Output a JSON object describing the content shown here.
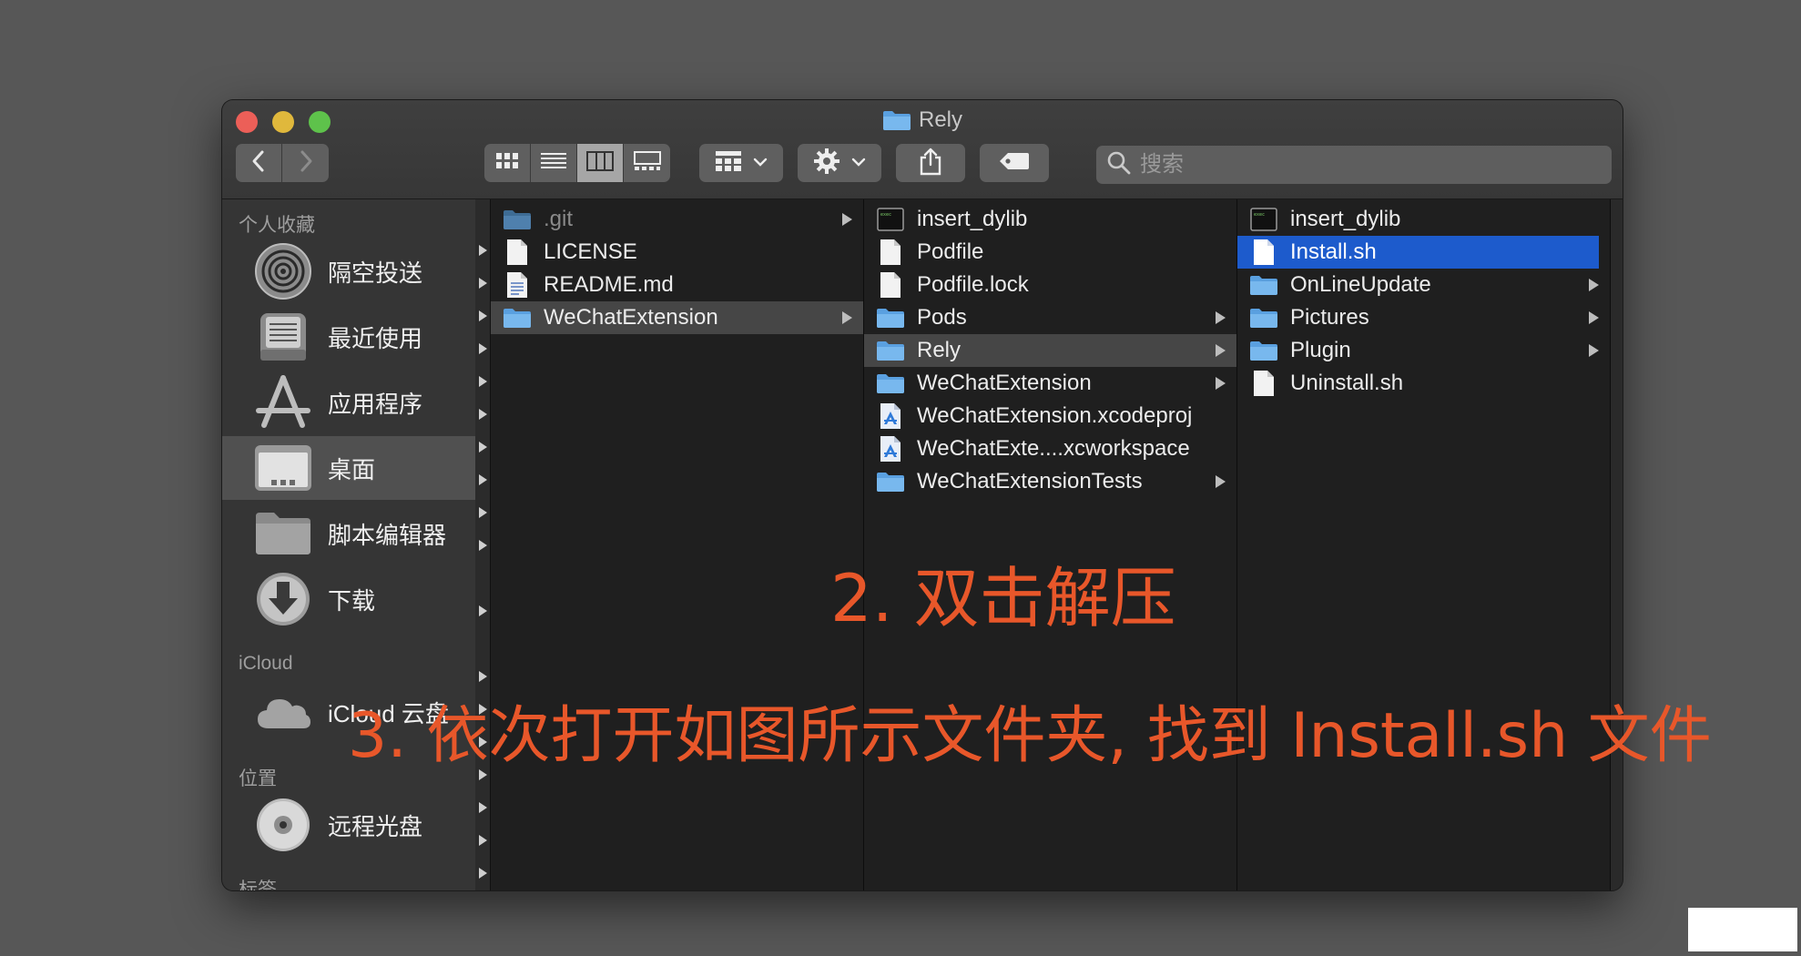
{
  "window": {
    "title": "Rely",
    "title_icon": "folder-icon",
    "traffic_lights": {
      "close": "#ec5f58",
      "minimize": "#e0b83c",
      "zoom": "#5ec24b"
    }
  },
  "toolbar": {
    "back_icon": "chevron-left-icon",
    "forward_icon": "chevron-right-icon",
    "view_modes": [
      "icon-view-icon",
      "list-view-icon",
      "column-view-icon",
      "gallery-view-icon"
    ],
    "active_view": "column-view-icon",
    "group_icon": "group-icon",
    "action_icon": "gear-icon",
    "share_icon": "share-icon",
    "tag_icon": "tag-icon",
    "search_placeholder": "搜索"
  },
  "sidebar": {
    "favorites_header": "个人收藏",
    "favorites": [
      {
        "label": "隔空投送",
        "icon": "airdrop-icon"
      },
      {
        "label": "最近使用",
        "icon": "recents-icon"
      },
      {
        "label": "应用程序",
        "icon": "applications-icon"
      },
      {
        "label": "桌面",
        "icon": "desktop-icon",
        "selected": true
      },
      {
        "label": "脚本编辑器",
        "icon": "folder-icon"
      },
      {
        "label": "下载",
        "icon": "download-icon"
      }
    ],
    "icloud_header": "iCloud",
    "icloud": [
      {
        "label": "iCloud 云盘",
        "icon": "cloud-icon"
      }
    ],
    "locations_header": "位置",
    "locations": [
      {
        "label": "远程光盘",
        "icon": "disc-icon"
      }
    ],
    "tags_header": "标签"
  },
  "columns": [
    {
      "items": [
        {
          "name": ".git",
          "type": "folder",
          "hidden": true,
          "has_children": true
        },
        {
          "name": "LICENSE",
          "type": "file"
        },
        {
          "name": "README.md",
          "type": "text"
        },
        {
          "name": "WeChatExtension",
          "type": "folder",
          "has_children": true,
          "selected": "gray"
        }
      ]
    },
    {
      "items": [
        {
          "name": "insert_dylib",
          "type": "exec"
        },
        {
          "name": "Podfile",
          "type": "file"
        },
        {
          "name": "Podfile.lock",
          "type": "file"
        },
        {
          "name": "Pods",
          "type": "folder",
          "has_children": true
        },
        {
          "name": "Rely",
          "type": "folder",
          "has_children": true,
          "selected": "gray"
        },
        {
          "name": "WeChatExtension",
          "type": "folder",
          "has_children": true
        },
        {
          "name": "WeChatExtension.xcodeproj",
          "type": "xcode"
        },
        {
          "name": "WeChatExte....xcworkspace",
          "type": "xcode"
        },
        {
          "name": "WeChatExtensionTests",
          "type": "folder",
          "has_children": true
        }
      ]
    },
    {
      "items": [
        {
          "name": "insert_dylib",
          "type": "exec"
        },
        {
          "name": "Install.sh",
          "type": "file",
          "selected": "blue"
        },
        {
          "name": "OnLineUpdate",
          "type": "folder",
          "has_children": true
        },
        {
          "name": "Pictures",
          "type": "folder",
          "has_children": true
        },
        {
          "name": "Plugin",
          "type": "folder",
          "has_children": true
        },
        {
          "name": "Uninstall.sh",
          "type": "file"
        }
      ]
    }
  ],
  "annotations": {
    "step2": "2. 双击解压",
    "step3": "3. 依次打开如图所示文件夹, 找到 Install.sh 文件",
    "color": "#e8572a"
  }
}
